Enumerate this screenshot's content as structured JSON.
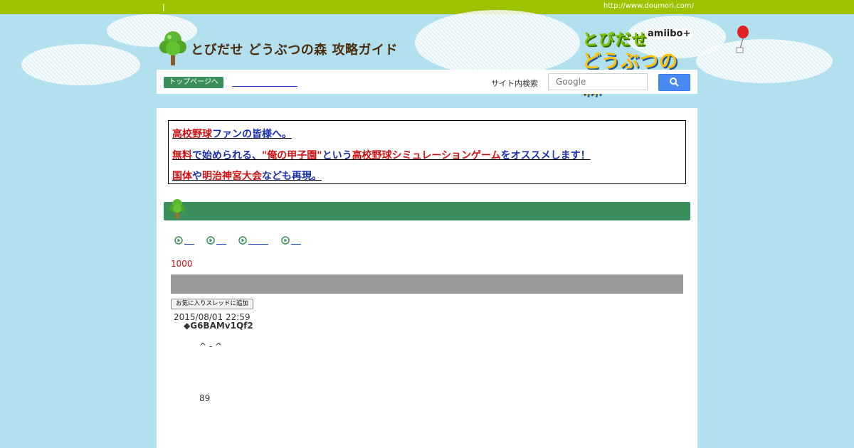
{
  "top_bar": {
    "separator": "|",
    "site_url": "http://www.doumori.com/"
  },
  "site": {
    "title": "とびだせ どうぶつの森 攻略ガイド"
  },
  "game_logo": {
    "line1": "とびだせ",
    "line2": "どうぶつの森",
    "badge": "amiibo+"
  },
  "nav": {
    "top_page_button": "トップページへ",
    "search_label": "サイト内検索",
    "search_placeholder": "Google"
  },
  "ad": {
    "line1": [
      {
        "text": "高校野球",
        "color": "red"
      },
      {
        "text": "ファンの皆様へ。",
        "color": "blue"
      }
    ],
    "line2": [
      {
        "text": "無料",
        "color": "red"
      },
      {
        "text": "で始められる、",
        "color": "blue"
      },
      {
        "text": "\"俺の甲子園\"",
        "color": "red"
      },
      {
        "text": "という",
        "color": "blue"
      },
      {
        "text": "高校野球シミュレーションゲーム",
        "color": "red"
      },
      {
        "text": "をオススメします！",
        "color": "blue"
      }
    ],
    "line3": [
      {
        "text": "国体",
        "color": "red"
      },
      {
        "text": "や",
        "color": "blue"
      },
      {
        "text": "明治神宮大会",
        "color": "red"
      },
      {
        "text": "なども再現。",
        "color": "blue"
      }
    ]
  },
  "thread": {
    "count": "1000",
    "favorite_button": "お気に入りスレッドに追加",
    "post": {
      "date": "2015/08/01 22:59",
      "trip": "◆G6BAMv1Qf2",
      "body_line1": "^ - ^",
      "body_line2": "89"
    }
  },
  "colors": {
    "sky": "#b3e0ee",
    "top_bar": "#9ec100",
    "green_bar": "#3b8f5c",
    "accent_red": "#d01010",
    "accent_blue": "#1a2fb0",
    "search_button": "#4a8af4"
  }
}
